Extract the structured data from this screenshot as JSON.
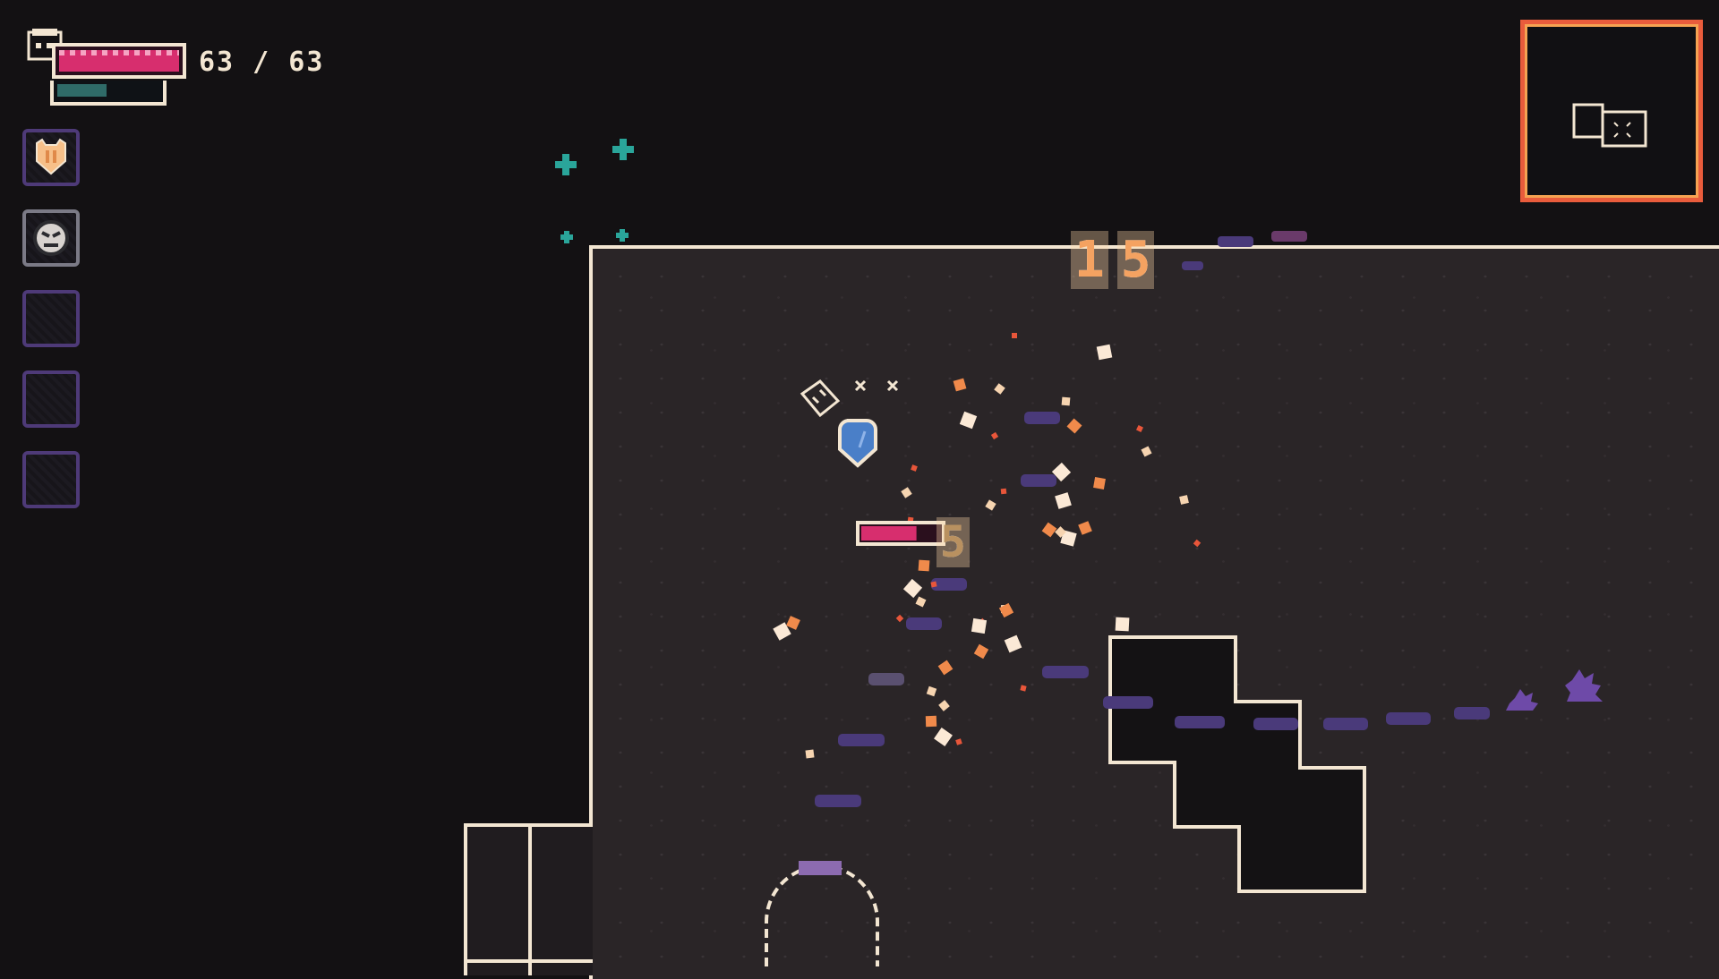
{
  "hud": {
    "hp_current": 63,
    "hp_max": 63,
    "hp_text": "63 / 63",
    "hp_fraction": 1.0,
    "energy_fraction": 0.45,
    "colors": {
      "hp": "#d72e6e",
      "energy": "#2f6b68",
      "frame": "#f3e6d2"
    }
  },
  "inventory": {
    "slots": [
      {
        "icon": "cat-shield-icon",
        "filled": true
      },
      {
        "icon": "cracked-face-icon",
        "filled": true
      },
      {
        "icon": "empty-slot",
        "filled": false
      },
      {
        "icon": "empty-slot",
        "filled": false
      },
      {
        "icon": "empty-slot",
        "filled": false
      }
    ]
  },
  "combat": {
    "damage_numbers": [
      "1",
      "5"
    ],
    "damage_number_small": "5",
    "enemy_hp_fraction": 0.7
  },
  "minimap": {
    "border_color": "#e95c3c"
  },
  "colors": {
    "floor": "#2a2527",
    "wall_line": "#f3e6d2",
    "background": "#131113",
    "enemy_trail": "#4a3a7a",
    "spark": "#e8563a",
    "player": "#4a7fc8"
  }
}
